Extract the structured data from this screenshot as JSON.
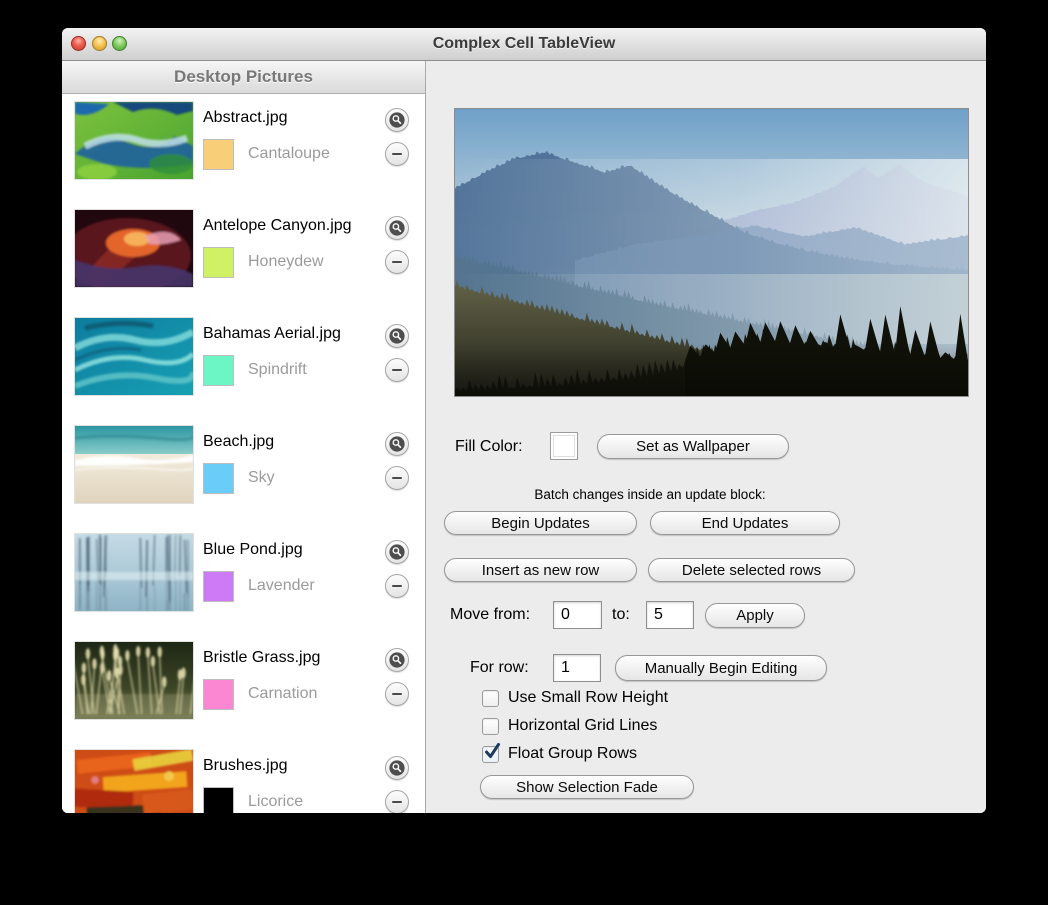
{
  "window": {
    "title": "Complex Cell TableView"
  },
  "sidebar": {
    "header": "Desktop Pictures",
    "rows": [
      {
        "name": "Abstract.jpg",
        "color_name": "Cantaloupe",
        "color": "#F9CE79",
        "thumb": "abstract"
      },
      {
        "name": "Antelope Canyon.jpg",
        "color_name": "Honeydew",
        "color": "#CFF163",
        "thumb": "canyon"
      },
      {
        "name": "Bahamas Aerial.jpg",
        "color_name": "Spindrift",
        "color": "#6CF6C5",
        "thumb": "bahamas"
      },
      {
        "name": "Beach.jpg",
        "color_name": "Sky",
        "color": "#69CDF8",
        "thumb": "beach"
      },
      {
        "name": "Blue Pond.jpg",
        "color_name": "Lavender",
        "color": "#CD7AF6",
        "thumb": "pond"
      },
      {
        "name": "Bristle Grass.jpg",
        "color_name": "Carnation",
        "color": "#FB87D3",
        "thumb": "grass"
      },
      {
        "name": "Brushes.jpg",
        "color_name": "Licorice",
        "color": "#000000",
        "thumb": "brushes"
      }
    ],
    "row_icons": [
      "magnifier-icon",
      "minus-icon"
    ]
  },
  "panel": {
    "fill_color_label": "Fill Color:",
    "set_wallpaper": "Set as Wallpaper",
    "batch_caption": "Batch changes inside an update block:",
    "begin_updates": "Begin Updates",
    "end_updates": "End Updates",
    "insert_row": "Insert as new row",
    "delete_rows": "Delete selected rows",
    "move_from_label": "Move from:",
    "move_from_value": "0",
    "to_label": "to:",
    "move_to_value": "5",
    "apply": "Apply",
    "for_row_label": "For row:",
    "for_row_value": "1",
    "manual_edit": "Manually Begin Editing",
    "checkboxes": [
      {
        "label": "Use Small Row Height",
        "checked": false
      },
      {
        "label": "Horizontal Grid Lines",
        "checked": false
      },
      {
        "label": "Float Group Rows",
        "checked": true
      }
    ],
    "show_fade": "Show Selection Fade"
  }
}
